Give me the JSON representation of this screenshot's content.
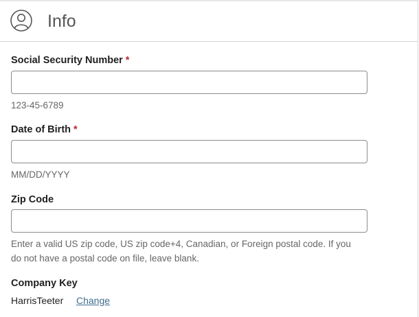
{
  "header": {
    "title": "Info",
    "icon": "user-circle-icon"
  },
  "form": {
    "ssn": {
      "label": "Social Security Number",
      "required_mark": "*",
      "value": "",
      "hint": "123-45-6789"
    },
    "dob": {
      "label": "Date of Birth",
      "required_mark": "*",
      "value": "",
      "hint": "MM/DD/YYYY"
    },
    "zip": {
      "label": "Zip Code",
      "value": "",
      "hint": "Enter a valid US zip code, US zip code+4, Canadian, or Foreign postal code. If you do not have a postal code on file, leave blank."
    },
    "company_key": {
      "label": "Company Key",
      "value": "HarrisTeeter",
      "change_label": "Change"
    }
  },
  "colors": {
    "required": "#c0262d",
    "link": "#3f6e8f",
    "hint_text": "#666666",
    "title_text": "#555555"
  }
}
